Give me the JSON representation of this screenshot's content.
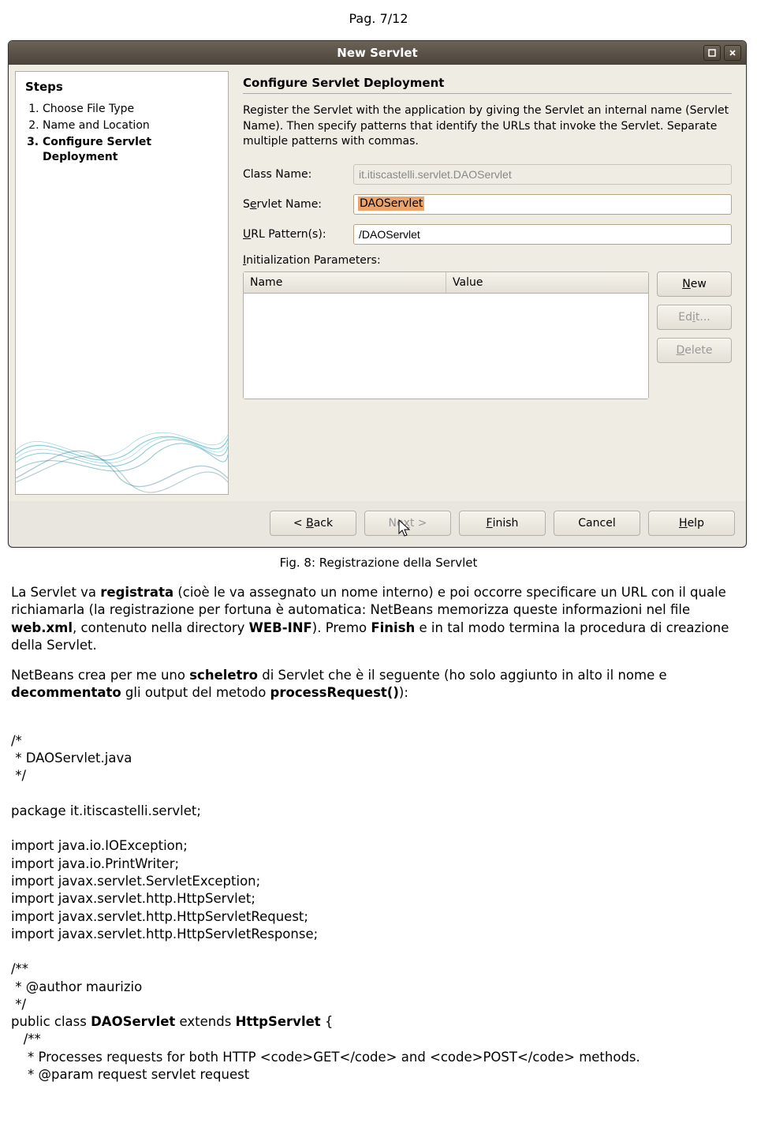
{
  "page_header": "Pag. 7/12",
  "window": {
    "title": "New Servlet",
    "steps_title": "Steps",
    "steps": [
      {
        "label": "Choose File Type",
        "current": false
      },
      {
        "label": "Name and Location",
        "current": false
      },
      {
        "label": "Configure Servlet Deployment",
        "current": true
      }
    ],
    "form_title": "Configure Servlet Deployment",
    "form_desc": "Register the Servlet with the application by giving the Servlet an internal name (Servlet Name). Then specify patterns that identify the URLs that invoke the Servlet. Separate multiple patterns with commas.",
    "class_name_label": "Class Name:",
    "class_name_value": "it.itiscastelli.servlet.DAOServlet",
    "servlet_name_label_pre": "S",
    "servlet_name_label_u": "e",
    "servlet_name_label_post": "rvlet Name:",
    "servlet_name_value": "DAOServlet",
    "url_pattern_label_pre": "",
    "url_pattern_label_u": "U",
    "url_pattern_label_post": "RL Pattern(s):",
    "url_pattern_value": "/DAOServlet",
    "init_params_label_u": "I",
    "init_params_label_post": "nitialization Parameters:",
    "th_name": "Name",
    "th_value": "Value",
    "btn_new_u": "N",
    "btn_new_post": "ew",
    "btn_edit_pre": "Ed",
    "btn_edit_u": "i",
    "btn_edit_post": "t...",
    "btn_delete_pre": "",
    "btn_delete_u": "D",
    "btn_delete_post": "elete",
    "btn_back": "< Back",
    "btn_back_u": "B",
    "btn_next_pre": "Ne",
    "btn_next_u": "x",
    "btn_next_post": "t >",
    "btn_finish_pre": "",
    "btn_finish_u": "F",
    "btn_finish_post": "inish",
    "btn_cancel": "Cancel",
    "btn_help_pre": "",
    "btn_help_u": "H",
    "btn_help_post": "elp"
  },
  "caption": "Fig. 8: Registrazione della Servlet",
  "para1_a": "La Servlet va ",
  "para1_b": "registrata",
  "para1_c": " (cioè le va assegnato un nome interno) e poi occorre specificare un URL con il quale richiamarla (la registrazione per fortuna è automatica: NetBeans memorizza queste informazioni nel file ",
  "para1_d": "web.xml",
  "para1_e": ", contenuto nella directory ",
  "para1_f": "WEB-INF",
  "para1_g": "). Premo ",
  "para1_h": "Finish",
  "para1_i": " e in tal modo termina la procedura di creazione della Servlet.",
  "para2_a": "NetBeans crea per me uno ",
  "para2_b": "scheletro",
  "para2_c": " di Servlet che è il seguente (ho solo aggiunto in alto il nome e ",
  "para2_d": "decommentato",
  "para2_e": " gli output del metodo ",
  "para2_f": "processRequest()",
  "para2_g": "):",
  "code_c1": "/*",
  "code_c2": " * DAOServlet.java",
  "code_c3": " */",
  "code_pkg": "package it.itiscastelli.servlet;",
  "code_i1": "import java.io.IOException;",
  "code_i2": "import java.io.PrintWriter;",
  "code_i3": "import javax.servlet.ServletException;",
  "code_i4": "import javax.servlet.http.HttpServlet;",
  "code_i5": "import javax.servlet.http.HttpServletRequest;",
  "code_i6": "import javax.servlet.http.HttpServletResponse;",
  "code_d1": "/**",
  "code_d2": " * @author maurizio",
  "code_d3": " */",
  "code_cl_a": "public class ",
  "code_cl_b": "DAOServlet",
  "code_cl_c": " extends ",
  "code_cl_d": "HttpServlet",
  "code_cl_e": " {",
  "code_m1": "   /**",
  "code_m2": "    * Processes requests for both HTTP <code>GET</code> and <code>POST</code> methods.",
  "code_m3": "    * @param request servlet request"
}
